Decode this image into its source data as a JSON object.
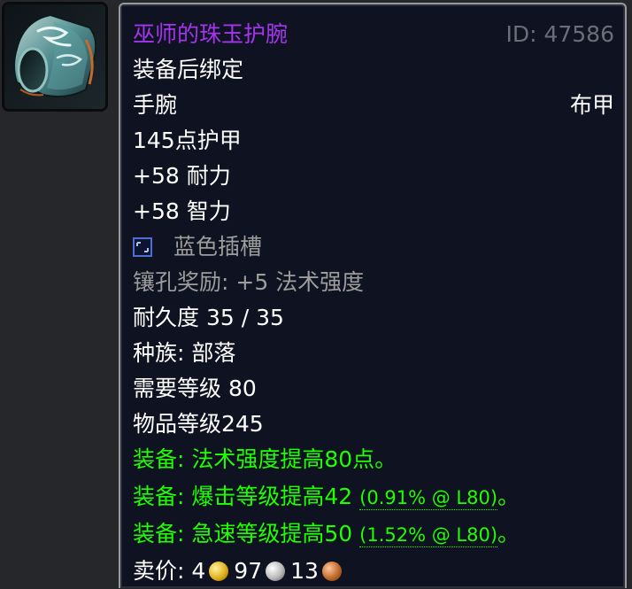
{
  "item": {
    "name": "巫师的珠玉护腕",
    "id_text": "ID: 47586",
    "bind": "装备后绑定",
    "slot": "手腕",
    "armor_type": "布甲",
    "armor": "145点护甲",
    "stats": [
      "+58 耐力",
      "+58 智力"
    ],
    "socket": {
      "label": "蓝色插槽",
      "icon": "blue-socket-icon"
    },
    "socket_bonus": "镶孔奖励: +5 法术强度",
    "durability": "耐久度 35 / 35",
    "race": "种族: 部落",
    "required_level": "需要等级 80",
    "item_level": "物品等级245",
    "effects": [
      {
        "text": "装备:  法术强度提高80点。",
        "note": ""
      },
      {
        "text": "装备:  爆击等级提高42",
        "note": "(0.91% @ L80)",
        "suffix": "。"
      },
      {
        "text": "装备:  急速等级提高50",
        "note": "(1.52% @ L80)",
        "suffix": "。"
      }
    ],
    "sell_price": {
      "label": "卖价:",
      "gold": "4",
      "silver": "97",
      "copper": "13"
    },
    "icon": "bracer-icon"
  },
  "colors": {
    "epic": "#a335ee",
    "uncommon": "#1eff00",
    "gray": "#9d9d9d",
    "background": "#0f1220"
  }
}
